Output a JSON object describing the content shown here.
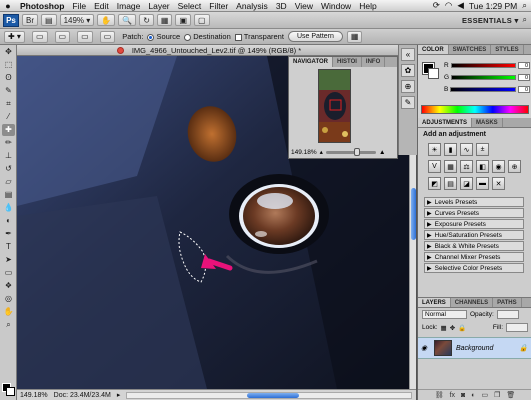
{
  "menubar": {
    "apple": "",
    "app_name": "Photoshop",
    "items": [
      "File",
      "Edit",
      "Image",
      "Layer",
      "Select",
      "Filter",
      "Analysis",
      "3D",
      "View",
      "Window",
      "Help"
    ],
    "clock": "Tue 1:29 PM"
  },
  "appbar": {
    "logo": "Ps",
    "zoom": "149%",
    "workspace": "ESSENTIALS ▾"
  },
  "options": {
    "patch_label": "Patch:",
    "source_label": "Source",
    "destination_label": "Destination",
    "transparent_label": "Transparent",
    "use_pattern_label": "Use Pattern"
  },
  "document": {
    "tab_title": "IMG_4966_Untouched_Lev2.tif @ 149% (RGB/8) *",
    "status_zoom": "149.18%",
    "status_doc": "Doc: 23.4M/23.4M"
  },
  "navigator": {
    "tabs": [
      "NAVIGATOR",
      "HISTOI",
      "INFO"
    ],
    "zoom": "149.18%"
  },
  "color_panel": {
    "tabs": [
      "COLOR",
      "SWATCHES",
      "STYLES"
    ],
    "channels": [
      {
        "label": "R",
        "value": "0",
        "color": "#ff0000"
      },
      {
        "label": "G",
        "value": "0",
        "color": "#00ff00"
      },
      {
        "label": "B",
        "value": "0",
        "color": "#0000ff"
      }
    ]
  },
  "adjustments": {
    "tabs": [
      "ADJUSTMENTS",
      "MASKS"
    ],
    "title": "Add an adjustment",
    "presets": [
      "Levels Presets",
      "Curves Presets",
      "Exposure Presets",
      "Hue/Saturation Presets",
      "Black & White Presets",
      "Channel Mixer Presets",
      "Selective Color Presets"
    ]
  },
  "layers": {
    "tabs": [
      "LAYERS",
      "CHANNELS",
      "PATHS"
    ],
    "blend_mode": "Normal",
    "opacity_label": "Opacity:",
    "lock_label": "Lock:",
    "fill_label": "Fill:",
    "layer_name": "Background"
  }
}
